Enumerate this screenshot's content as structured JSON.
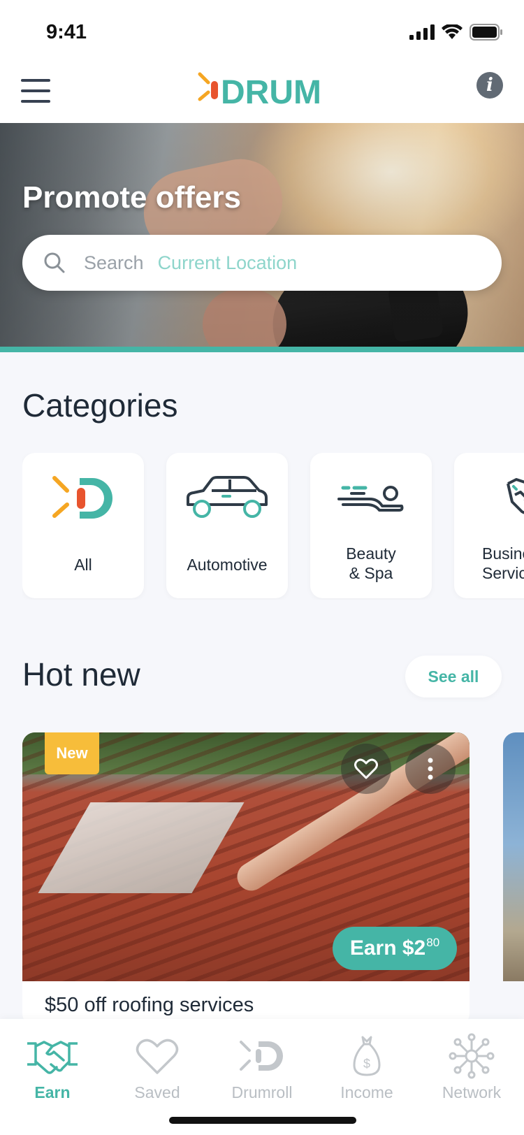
{
  "status_bar": {
    "time": "9:41"
  },
  "header": {
    "logo_text": "DRUM"
  },
  "hero": {
    "title": "Promote offers",
    "search_placeholder": "Search",
    "search_location": "Current Location"
  },
  "categories": {
    "title": "Categories",
    "items": [
      {
        "label": "All",
        "icon": "drum-logo-icon"
      },
      {
        "label": "Automotive",
        "icon": "car-icon"
      },
      {
        "label_line1": "Beauty",
        "label_line2": "& Spa",
        "icon": "spa-icon"
      },
      {
        "label_line1": "Business",
        "label_line2": "Services",
        "icon": "handshake-icon"
      }
    ]
  },
  "hot_new": {
    "title": "Hot new",
    "see_all": "See all",
    "offers": [
      {
        "badge": "New",
        "earn_label": "Earn $2",
        "earn_cents": "80",
        "title": "$50 off roofing services"
      }
    ]
  },
  "tab_bar": {
    "tabs": [
      {
        "label": "Earn",
        "icon": "handshake-icon",
        "active": true
      },
      {
        "label": "Saved",
        "icon": "heart-icon",
        "active": false
      },
      {
        "label": "Drumroll",
        "icon": "drum-logo-icon",
        "active": false
      },
      {
        "label": "Income",
        "icon": "money-bag-icon",
        "active": false
      },
      {
        "label": "Network",
        "icon": "network-icon",
        "active": false
      }
    ]
  },
  "colors": {
    "accent": "#45b5a6",
    "badge": "#f7bd3a",
    "logo_orange": "#f5a623",
    "logo_red": "#e8542e"
  }
}
